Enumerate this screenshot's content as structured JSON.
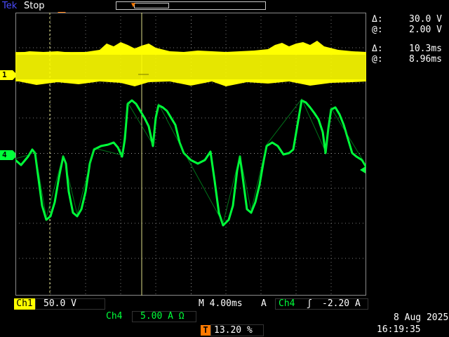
{
  "header": {
    "brand": "Tek",
    "run_state": "Stop"
  },
  "readouts": {
    "delta_v_label": "Δ:",
    "delta_v_value": "30.0 V",
    "at_v_label": "@:",
    "at_v_value": "2.00 V",
    "delta_t_label": "Δ:",
    "delta_t_value": "10.3ms",
    "at_t_label": "@:",
    "at_t_value": "8.96ms"
  },
  "channels": {
    "ch1_marker": "1",
    "ch4_marker": "4",
    "ch1_color": "#ffff00",
    "ch4_color": "#00ff3a"
  },
  "footer": {
    "ch1_label": "Ch1",
    "ch1_scale": "50.0 V",
    "timebase": "M 4.00ms",
    "trigger_mode": "A",
    "trigger_source": "Ch4",
    "trigger_slope": "ʃ",
    "trigger_level": "-2.20 A",
    "ch4_label": "Ch4",
    "ch4_scale": "5.00 A Ω",
    "trigger_pos_icon": "T",
    "trigger_position": "13.20 %",
    "date": "8 Aug 2025",
    "time": "16:19:35"
  },
  "icons": {
    "trigger_marker": "trigger-position-icon",
    "record_marker": "record-position-icon"
  }
}
